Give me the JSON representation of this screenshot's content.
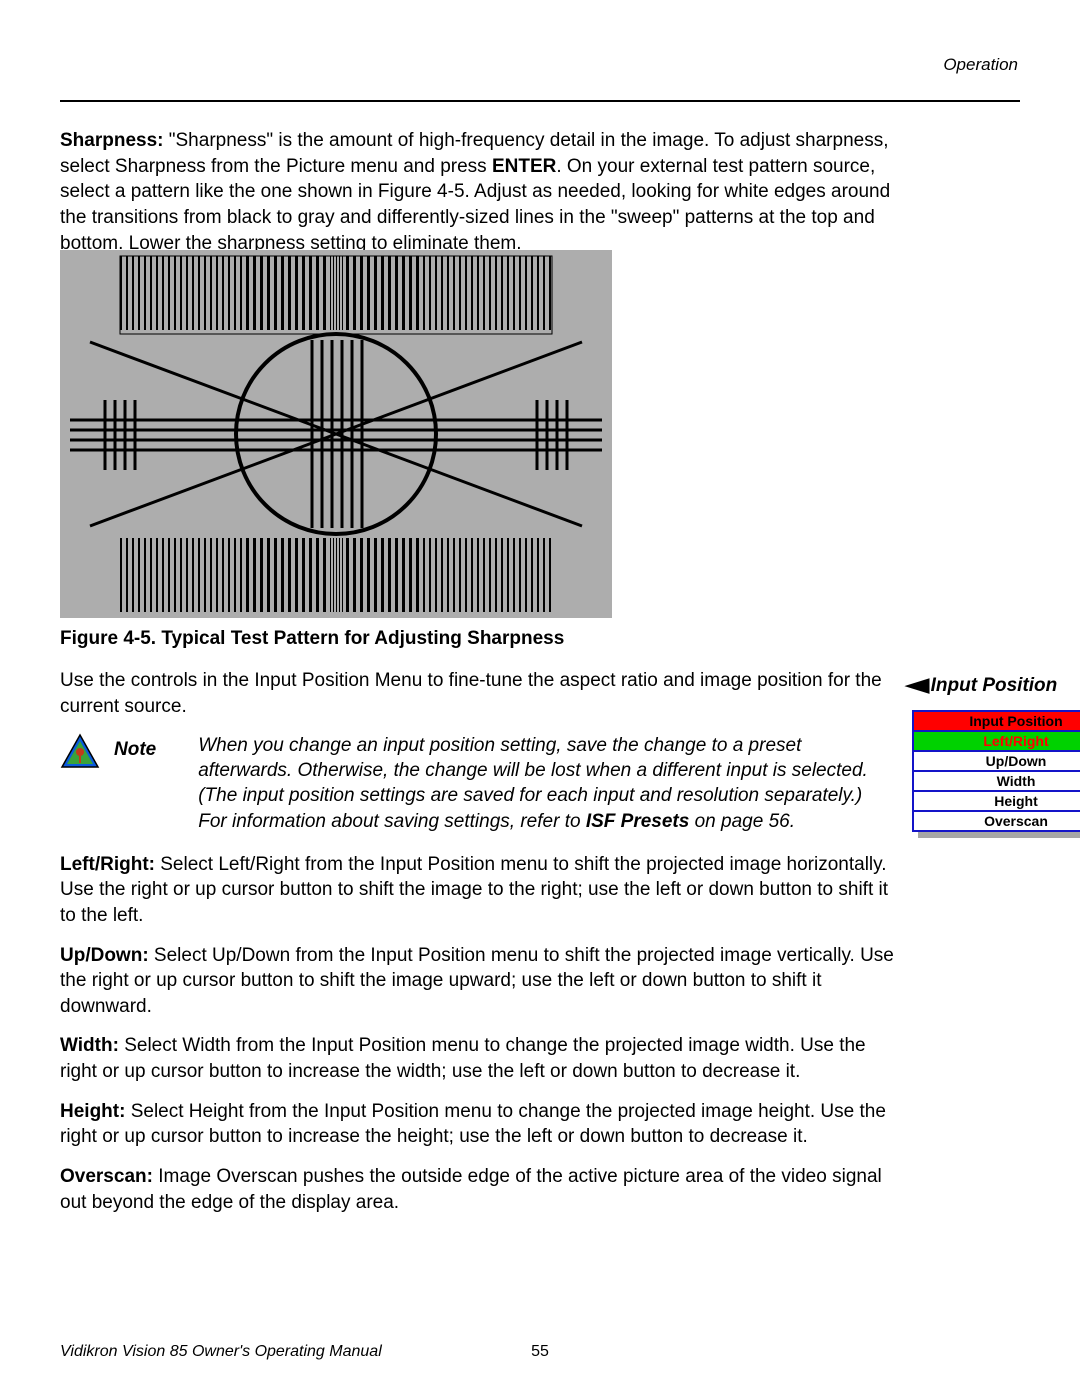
{
  "header": {
    "section": "Operation"
  },
  "sharpness": {
    "title": "Sharpness:",
    "body_a": " \"Sharpness\" is the amount of high-frequency detail in the image. To adjust sharpness, select Sharpness from the Picture menu and press ",
    "enter": "ENTER",
    "body_b": ". On your external test pattern source, select a pattern like the one shown in Figure 4-5. Adjust as needed, looking for white edges around the transitions from black to gray and differently-sized lines in the \"sweep\" patterns at the top and bottom. Lower the sharpness setting to eliminate them."
  },
  "figure": {
    "caption": "Figure 4-5. Typical Test Pattern for Adjusting Sharpness"
  },
  "inputpos": {
    "intro": "Use the controls in the Input Position Menu to fine-tune the aspect ratio and image position for the current source.",
    "sideheading": "Input Position",
    "note_label": "Note",
    "note_a": "When you change an input position setting, save the change to a preset afterwards. Otherwise, the change will be lost when a different input is selected. (The input position settings are saved for each input and resolution separately.) For information about saving settings, refer to ",
    "note_isf": "ISF Presets",
    "note_b": " on page 56."
  },
  "menu": {
    "header": "Input Position",
    "items": [
      "Left/Right",
      "Up/Down",
      "Width",
      "Height",
      "Overscan"
    ]
  },
  "leftright": {
    "title": "Left/Right:",
    "body": " Select Left/Right from the Input Position menu to shift the projected image horizontally. Use the right or up cursor button to shift the image to the right; use the left or down button to shift it to the left."
  },
  "updown": {
    "title": "Up/Down:",
    "body": " Select Up/Down from the Input Position menu to shift the projected image vertically. Use the right or up cursor button to shift the image upward; use the left or down button to shift it downward."
  },
  "width": {
    "title": "Width:",
    "body": " Select Width from the Input Position menu to change the projected image width. Use the right or up cursor button to increase the width; use the left or down button to decrease it."
  },
  "height": {
    "title": "Height:",
    "body": " Select Height from the Input Position menu to change the projected image height. Use the right or up cursor button to increase the height; use the left or down button to decrease it."
  },
  "overscan": {
    "title": "Overscan:",
    "body": " Image Overscan pushes the outside edge of the active picture area of the video signal out beyond the edge of the display area."
  },
  "footer": {
    "manual": "Vidikron Vision 85 Owner's Operating Manual",
    "page": "55"
  }
}
